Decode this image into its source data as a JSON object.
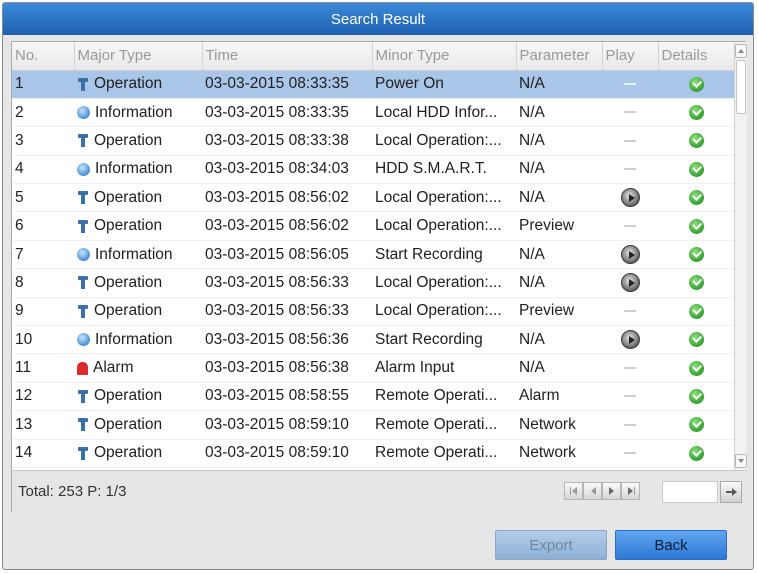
{
  "dialog": {
    "title": "Search Result"
  },
  "table": {
    "columns": [
      {
        "key": "no",
        "label": "No."
      },
      {
        "key": "major",
        "label": "Major Type"
      },
      {
        "key": "time",
        "label": "Time"
      },
      {
        "key": "minor",
        "label": "Minor Type"
      },
      {
        "key": "param",
        "label": "Parameter"
      },
      {
        "key": "play",
        "label": "Play"
      },
      {
        "key": "details",
        "label": "Details"
      }
    ],
    "selected_row": 1,
    "rows": [
      {
        "no": "1",
        "major": "Operation",
        "major_icon": "wrench-icon",
        "time": "03-03-2015 08:33:35",
        "minor": "Power On",
        "param": "N/A",
        "play": false
      },
      {
        "no": "2",
        "major": "Information",
        "major_icon": "info-icon",
        "time": "03-03-2015 08:33:35",
        "minor": "Local HDD Infor...",
        "param": "N/A",
        "play": false
      },
      {
        "no": "3",
        "major": "Operation",
        "major_icon": "wrench-icon",
        "time": "03-03-2015 08:33:38",
        "minor": "Local Operation:...",
        "param": "N/A",
        "play": false
      },
      {
        "no": "4",
        "major": "Information",
        "major_icon": "info-icon",
        "time": "03-03-2015 08:34:03",
        "minor": "HDD S.M.A.R.T.",
        "param": "N/A",
        "play": false
      },
      {
        "no": "5",
        "major": "Operation",
        "major_icon": "wrench-icon",
        "time": "03-03-2015 08:56:02",
        "minor": "Local Operation:...",
        "param": "N/A",
        "play": true
      },
      {
        "no": "6",
        "major": "Operation",
        "major_icon": "wrench-icon",
        "time": "03-03-2015 08:56:02",
        "minor": "Local Operation:...",
        "param": "Preview",
        "play": false
      },
      {
        "no": "7",
        "major": "Information",
        "major_icon": "info-icon",
        "time": "03-03-2015 08:56:05",
        "minor": "Start Recording",
        "param": "N/A",
        "play": true
      },
      {
        "no": "8",
        "major": "Operation",
        "major_icon": "wrench-icon",
        "time": "03-03-2015 08:56:33",
        "minor": "Local Operation:...",
        "param": "N/A",
        "play": true
      },
      {
        "no": "9",
        "major": "Operation",
        "major_icon": "wrench-icon",
        "time": "03-03-2015 08:56:33",
        "minor": "Local Operation:...",
        "param": "Preview",
        "play": false
      },
      {
        "no": "10",
        "major": "Information",
        "major_icon": "info-icon",
        "time": "03-03-2015 08:56:36",
        "minor": "Start Recording",
        "param": "N/A",
        "play": true
      },
      {
        "no": "11",
        "major": "Alarm",
        "major_icon": "alarm-icon",
        "time": "03-03-2015 08:56:38",
        "minor": "Alarm Input",
        "param": "N/A",
        "play": false
      },
      {
        "no": "12",
        "major": "Operation",
        "major_icon": "wrench-icon",
        "time": "03-03-2015 08:58:55",
        "minor": "Remote Operati...",
        "param": "Alarm",
        "play": false
      },
      {
        "no": "13",
        "major": "Operation",
        "major_icon": "wrench-icon",
        "time": "03-03-2015 08:59:10",
        "minor": "Remote Operati...",
        "param": "Network",
        "play": false
      },
      {
        "no": "14",
        "major": "Operation",
        "major_icon": "wrench-icon",
        "time": "03-03-2015 08:59:10",
        "minor": "Remote Operati...",
        "param": "Network",
        "play": false
      }
    ]
  },
  "footer": {
    "total_text": "Total: 253  P: 1/3",
    "page_input": ""
  },
  "buttons": {
    "export_label": "Export",
    "back_label": "Back"
  },
  "colors": {
    "title_bar": "#2a70c4",
    "selected_row": "#a9c5e8",
    "back_button": "#3d8be3",
    "export_button_disabled": "#9fbde0",
    "ok_green": "#3aa832"
  }
}
